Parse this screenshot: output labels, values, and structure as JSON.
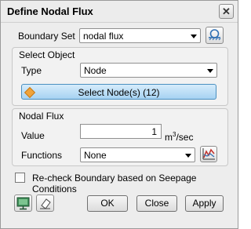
{
  "window": {
    "title": "Define Nodal Flux",
    "close_glyph": "✕"
  },
  "boundary_set": {
    "label": "Boundary Set",
    "value": "nodal flux"
  },
  "select_object": {
    "group_label": "Select Object",
    "type_label": "Type",
    "type_value": "Node",
    "select_button": "Select Node(s) (12)"
  },
  "nodal_flux": {
    "group_label": "Nodal Flux",
    "value_label": "Value",
    "value": "1",
    "unit_base": "m",
    "unit_exp": "3",
    "unit_rest": "/sec",
    "functions_label": "Functions",
    "functions_value": "None"
  },
  "recheck": {
    "label": "Re-check Boundary based on Seepage Conditions",
    "checked": false
  },
  "buttons": {
    "ok": "OK",
    "close": "Close",
    "apply": "Apply"
  },
  "icons": {
    "boundary_set": "boundary-manager-icon",
    "functions": "function-graph-icon",
    "left1": "display-icon",
    "left2": "eraser-icon"
  }
}
